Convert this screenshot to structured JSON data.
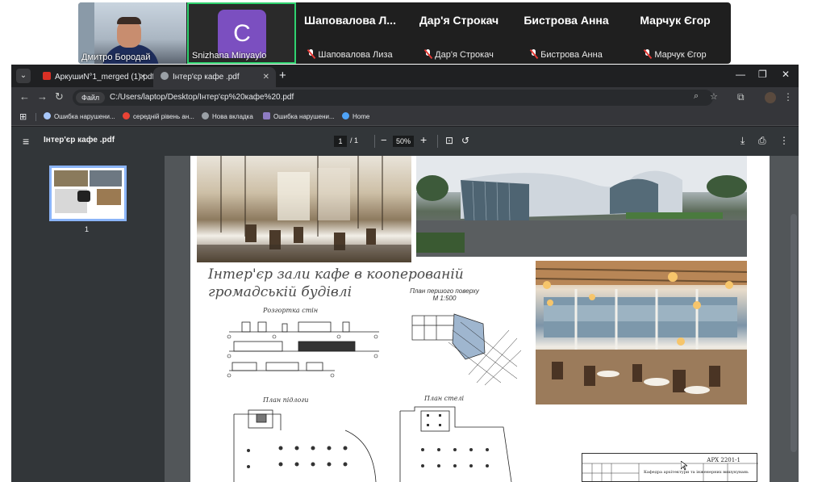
{
  "call": {
    "self_name": "Дмитро Бородай",
    "presenter": {
      "initial": "C",
      "name": "Snizhana Minyaylo",
      "avatar_color": "#7b4fc0",
      "highlight_color": "#2fd26f"
    },
    "participants": [
      {
        "name": "Шаповалова  Л...",
        "sub": "Шаповалова Лиза"
      },
      {
        "name": "Дар'я Строкач",
        "sub": "Дар'я Строкач"
      },
      {
        "name": "Бистрова Анна",
        "sub": "Бистрова Анна"
      },
      {
        "name": "Марчук Єгор",
        "sub": "Марчук Єгор"
      }
    ]
  },
  "browser": {
    "tabs": [
      {
        "title": "АркушиN°1_merged (1).pdf",
        "active": false
      },
      {
        "title": "Інтер'єр кафе .pdf",
        "active": true
      }
    ],
    "omnibox": {
      "chip": "Файл",
      "url": "C:/Users/laptop/Desktop/Інтер'єр%20кафе%20.pdf"
    },
    "bookmarks": [
      {
        "label": "Ошибка нарушени...",
        "icon_color": "#a8c7fa"
      },
      {
        "label": "середній рівень ан...",
        "icon_color": "#ea4335"
      },
      {
        "label": "Нова вкладка",
        "icon_color": "#9aa0a6"
      },
      {
        "label": "Ошибка нарушени...",
        "icon_color": "#8e7cc3"
      },
      {
        "label": "Home",
        "icon_color": "#4fa3f7"
      }
    ]
  },
  "pdf": {
    "title": "Інтер'єр кафе .pdf",
    "page_current": "1",
    "page_total": "/  1",
    "zoom": "50%",
    "thumb_page": "1",
    "sheet": {
      "title_line1": "Інтер'єр зали кафе в кооперованій",
      "title_line2": "громадській будівлі",
      "caption_razgortka": "Розгортка стін",
      "caption_plan1_line1": "План першого поверху",
      "caption_plan1_line2": "М 1:500",
      "caption_floor": "План підлоги",
      "caption_ceiling": "План стелі",
      "stamp_code": "АРХ 2201-1",
      "stamp_dept": "Кафедра архітектури та інженерних вишукувань"
    }
  }
}
